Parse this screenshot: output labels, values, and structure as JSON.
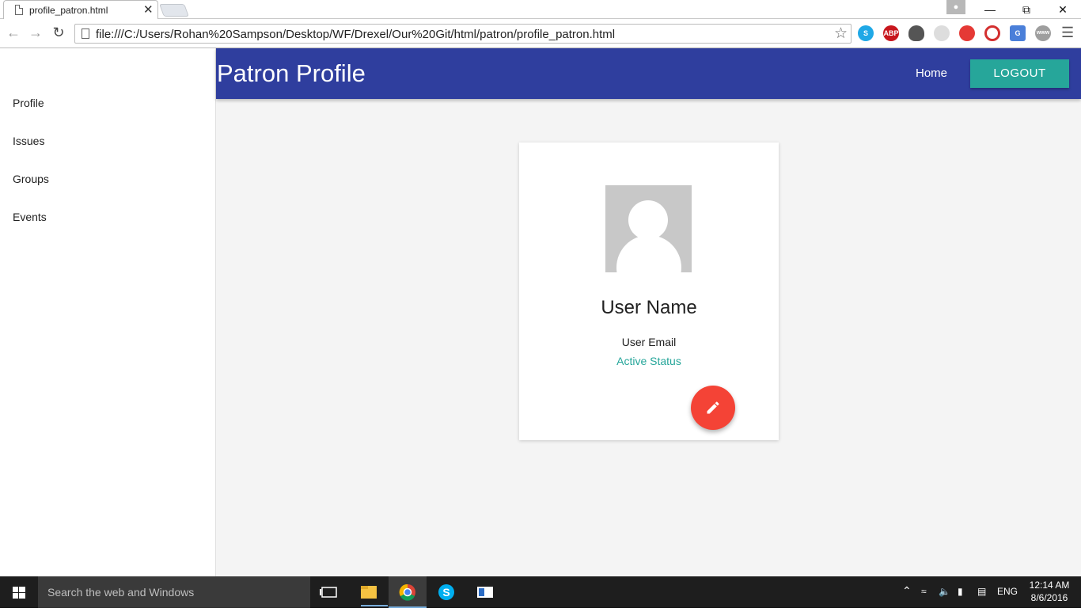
{
  "browser": {
    "tab_title": "profile_patron.html",
    "tab_close": "✕",
    "url": "file:///C:/Users/Rohan%20Sampson/Desktop/WF/Drexel/Our%20Git/html/patron/profile_patron.html",
    "ext_abp": "ABP",
    "ext_skype": "S",
    "ext_translate": "G",
    "ext_www": "www"
  },
  "sidebar": {
    "items": [
      {
        "label": "Profile"
      },
      {
        "label": "Issues"
      },
      {
        "label": "Groups"
      },
      {
        "label": "Events"
      }
    ]
  },
  "header": {
    "title": "Patron Profile",
    "home_label": "Home",
    "logout_label": "LOGOUT"
  },
  "profile": {
    "name": "User Name",
    "email": "User Email",
    "status": "Active Status"
  },
  "taskbar": {
    "search_placeholder": "Search the web and Windows",
    "language": "ENG",
    "time": "12:14 AM",
    "date": "8/6/2016"
  },
  "colors": {
    "appbar": "#2f3e9e",
    "accent": "#26a69a",
    "fab": "#f44336"
  }
}
